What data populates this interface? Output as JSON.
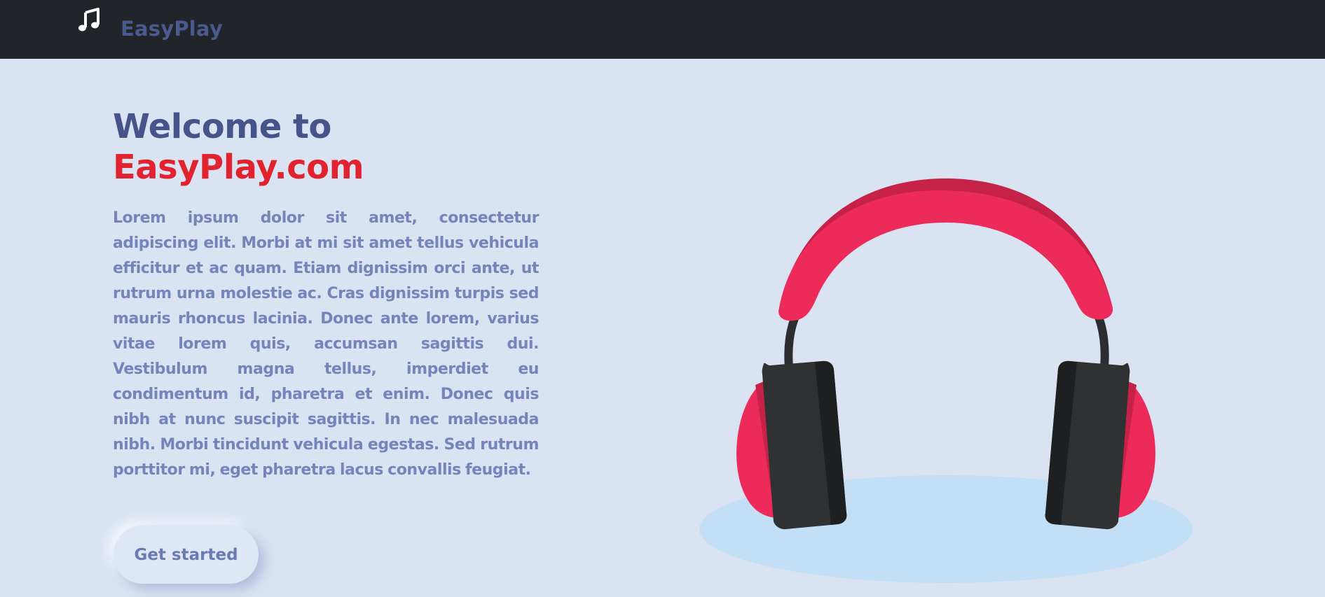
{
  "navbar": {
    "brand": "EasyPlay",
    "logo_icon": "music-note-icon"
  },
  "hero": {
    "title_line1": "Welcome to",
    "title_line2": "EasyPlay.com",
    "description": "Lorem ipsum dolor sit amet, consectetur adipiscing elit. Morbi at mi sit amet tellus vehicula efficitur et ac quam. Etiam dignissim orci ante, ut rutrum urna molestie ac. Cras dignissim turpis sed mauris rhoncus lacinia. Donec ante lorem, varius vitae lorem quis, accumsan sagittis dui. Vestibulum magna tellus, imperdiet eu condimentum id, pharetra et enim. Donec quis nibh at nunc suscipit sagittis. In nec malesuada nibh. Morbi tincidunt vehicula egestas. Sed rutrum porttitor mi, eget pharetra lacus convallis feugiat.",
    "cta_label": "Get started",
    "illustration_icon": "headphones-icon"
  },
  "colors": {
    "navbar_bg": "#212429",
    "page_bg": "#dae3f2",
    "brand_text": "#4a5a8c",
    "accent_red": "#e1222f",
    "body_text": "#7585bb",
    "headphone_band": "#ed2b5a",
    "headphone_cup": "#2f3133",
    "shadow_ellipse": "#c3dff5"
  }
}
